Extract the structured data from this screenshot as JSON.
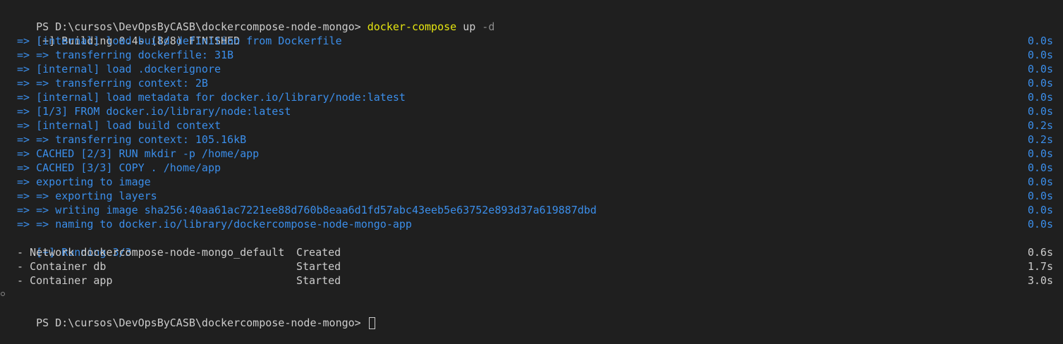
{
  "prompt": {
    "path": "PS D:\\cursos\\DevOpsByCASB\\dockercompose-node-mongo>",
    "command": "docker-compose",
    "arg": "up",
    "flag": "-d"
  },
  "build": {
    "header": "[+] Building 0.4s (8/8) FINISHED",
    "steps": [
      {
        "text": " => [internal] load build definition from Dockerfile",
        "time": "0.0s"
      },
      {
        "text": " => => transferring dockerfile: 31B",
        "time": "0.0s"
      },
      {
        "text": " => [internal] load .dockerignore",
        "time": "0.0s"
      },
      {
        "text": " => => transferring context: 2B",
        "time": "0.0s"
      },
      {
        "text": " => [internal] load metadata for docker.io/library/node:latest",
        "time": "0.0s"
      },
      {
        "text": " => [1/3] FROM docker.io/library/node:latest",
        "time": "0.0s"
      },
      {
        "text": " => [internal] load build context",
        "time": "0.2s"
      },
      {
        "text": " => => transferring context: 105.16kB",
        "time": "0.2s"
      },
      {
        "text": " => CACHED [2/3] RUN mkdir -p /home/app",
        "time": "0.0s"
      },
      {
        "text": " => CACHED [3/3] COPY . /home/app",
        "time": "0.0s"
      },
      {
        "text": " => exporting to image",
        "time": "0.0s"
      },
      {
        "text": " => => exporting layers",
        "time": "0.0s"
      },
      {
        "text": " => => writing image sha256:40aa61ac7221ee88d760b8eaa6d1fd57abc43eeb5e63752e893d37a619887dbd",
        "time": "0.0s"
      },
      {
        "text": " => => naming to docker.io/library/dockercompose-node-mongo-app",
        "time": "0.0s"
      }
    ]
  },
  "running": {
    "header": "[+] Running 3/3",
    "items": [
      {
        "name": " - Network dockercompose-node-mongo_default",
        "status": "Created",
        "time": "0.6s"
      },
      {
        "name": " - Container db",
        "status": "Started",
        "time": "1.7s"
      },
      {
        "name": " - Container app",
        "status": "Started",
        "time": "3.0s"
      }
    ]
  },
  "final_prompt": {
    "path": "PS D:\\cursos\\DevOpsByCASB\\dockercompose-node-mongo>"
  },
  "colors": {
    "background": "#1f1f1f",
    "command_yellow": "#e5e510",
    "build_blue": "#3b8eea",
    "text": "#cccccc"
  }
}
